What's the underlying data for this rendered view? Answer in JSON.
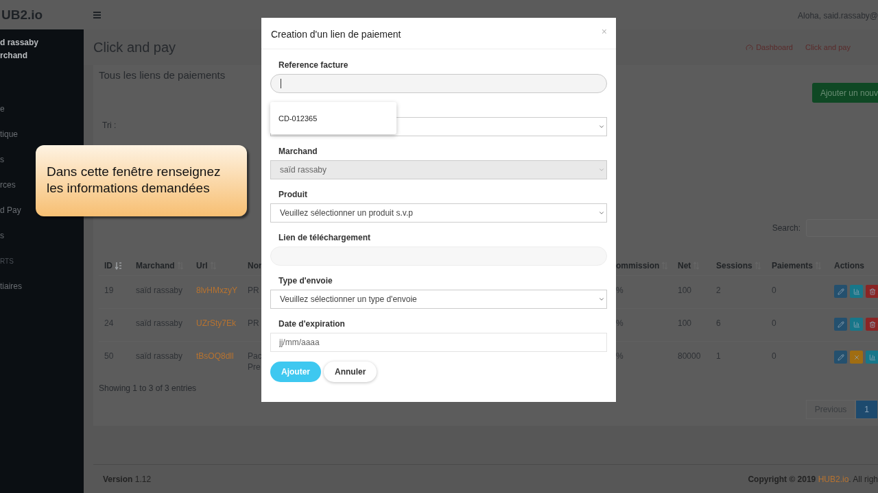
{
  "topbar": {
    "brand": "UB2.io",
    "greeting": "Aloha, said.rassaby@"
  },
  "sidebar": {
    "user_name": "d rassaby",
    "user_role": "rchand",
    "items": [
      {
        "label": "e",
        "kind": "link"
      },
      {
        "label": "tique",
        "kind": "link"
      },
      {
        "label": "s",
        "kind": "link"
      },
      {
        "label": "rces",
        "kind": "link"
      },
      {
        "label": "d Pay",
        "kind": "link"
      },
      {
        "label": "s",
        "kind": "link"
      },
      {
        "label": "RTS",
        "kind": "heading"
      },
      {
        "label": "tiaires",
        "kind": "link"
      }
    ]
  },
  "page": {
    "title": "Click and pay",
    "breadcrumbs": [
      "Dashboard",
      "Click and pay"
    ]
  },
  "card": {
    "title": "Tous les liens de paiements",
    "add_button": "Ajouter un nouv",
    "sort_label": "Tri :",
    "search_label": "Search:",
    "columns": [
      {
        "label": "ID",
        "sorted": true
      },
      {
        "label": "Marchand",
        "sorted": false
      },
      {
        "label": "Url",
        "sorted": false
      },
      {
        "label": "Nor"
      },
      {
        "label": "ommission",
        "sorted": false
      },
      {
        "label": "Net",
        "sorted": false
      },
      {
        "label": "Sessions",
        "sorted": false
      },
      {
        "label": "Paiements",
        "sorted": false
      },
      {
        "label": "Actions"
      }
    ],
    "rows": [
      {
        "id": "19",
        "merchant": "saïd rassaby",
        "url": "8lvHMxzyY",
        "name": [
          "PR"
        ],
        "commission": "%",
        "net": "100",
        "sessions": "2",
        "payments": "0",
        "actions": [
          {
            "kind": "edit"
          },
          {
            "kind": "stats"
          },
          {
            "kind": "delete"
          }
        ]
      },
      {
        "id": "24",
        "merchant": "saïd rassaby",
        "url": "UZrSty7Ek",
        "name": [
          "PR"
        ],
        "commission": "%",
        "net": "100",
        "sessions": "6",
        "payments": "0",
        "actions": [
          {
            "kind": "edit"
          },
          {
            "kind": "stats"
          },
          {
            "kind": "delete"
          }
        ]
      },
      {
        "id": "50",
        "merchant": "saïd rassaby",
        "url": "tBsOQ8dll",
        "name": [
          "Pac",
          "Pre"
        ],
        "commission": "%",
        "net": "80000",
        "sessions": "1",
        "payments": "0",
        "actions": [
          {
            "kind": "edit"
          },
          {
            "kind": "cancel"
          },
          {
            "kind": "stats"
          }
        ]
      }
    ],
    "info": "Showing 1 to 3 of 3 entries",
    "pagination": [
      {
        "label": "Previous",
        "selected": false
      },
      {
        "label": "1",
        "selected": true
      }
    ]
  },
  "footer": {
    "version_label": "Version",
    "version": "1.12",
    "copyright": "Copyright © 2019 ",
    "brand": "HUB2.io",
    "rights": ". All righ"
  },
  "callout": {
    "text": "Dans cette fenêtre renseignez les informations demandées"
  },
  "modal": {
    "title": "Creation d'un lien de paiement",
    "close": "×",
    "fields": [
      {
        "kind": "text",
        "label": "Reference facture",
        "focused": true,
        "suggestions": [
          "CD-012365"
        ]
      },
      {
        "kind": "select",
        "disabled": false
      },
      {
        "kind": "select",
        "label": "Marchand",
        "value": "saïd rassaby",
        "disabled": true
      },
      {
        "kind": "select",
        "label": "Produit",
        "value": "Veuillez sélectionner un produit s.v.p",
        "disabled": false
      },
      {
        "kind": "text",
        "label": "Lien de téléchargement",
        "focused": false
      },
      {
        "kind": "select",
        "label": "Type d'envoie",
        "value": "Veuillez sélectionner un type d'envoie",
        "disabled": false
      },
      {
        "kind": "date",
        "label": "Date d'expiration",
        "placeholder": "jj/mm/aaaa"
      }
    ],
    "buttons": [
      {
        "label": "Ajouter",
        "kind": "primary"
      },
      {
        "label": "Annuler",
        "kind": "default"
      }
    ]
  }
}
